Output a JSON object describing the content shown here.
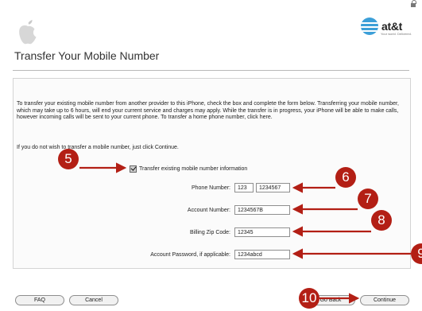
{
  "header": {
    "att_logo_text": "at&t",
    "att_tagline": "Your world. Delivered.",
    "page_title": "Transfer Your Mobile Number"
  },
  "body": {
    "paragraph1": "To transfer your existing mobile number from another provider to this iPhone, check the box and complete the form below. Transferring your mobile number, which may take up to 6 hours, will end your current service and charges may apply. While the transfer is in progress, your iPhone will be able to make calls, however incoming calls will be sent to your current phone. To transfer a home phone number, click here.",
    "paragraph2": "If you do not wish to transfer a mobile number, just click Continue.",
    "checkbox_label": "Transfer existing mobile number information"
  },
  "form": {
    "phone_label": "Phone Number:",
    "phone_area": "123",
    "phone_number": "1234567",
    "account_label": "Account Number:",
    "account_value": "1234567B",
    "zip_label": "Billing Zip Code:",
    "zip_value": "12345",
    "password_label": "Account Password, if applicable:",
    "password_value": "1234abcd"
  },
  "buttons": {
    "faq": "FAQ",
    "cancel": "Cancel",
    "go_back": "Go Back",
    "continue": "Continue"
  },
  "callouts": [
    "5",
    "6",
    "7",
    "8",
    "9",
    "10"
  ],
  "colors": {
    "callout": "#b31f15",
    "att_blue": "#3c9fd8"
  }
}
